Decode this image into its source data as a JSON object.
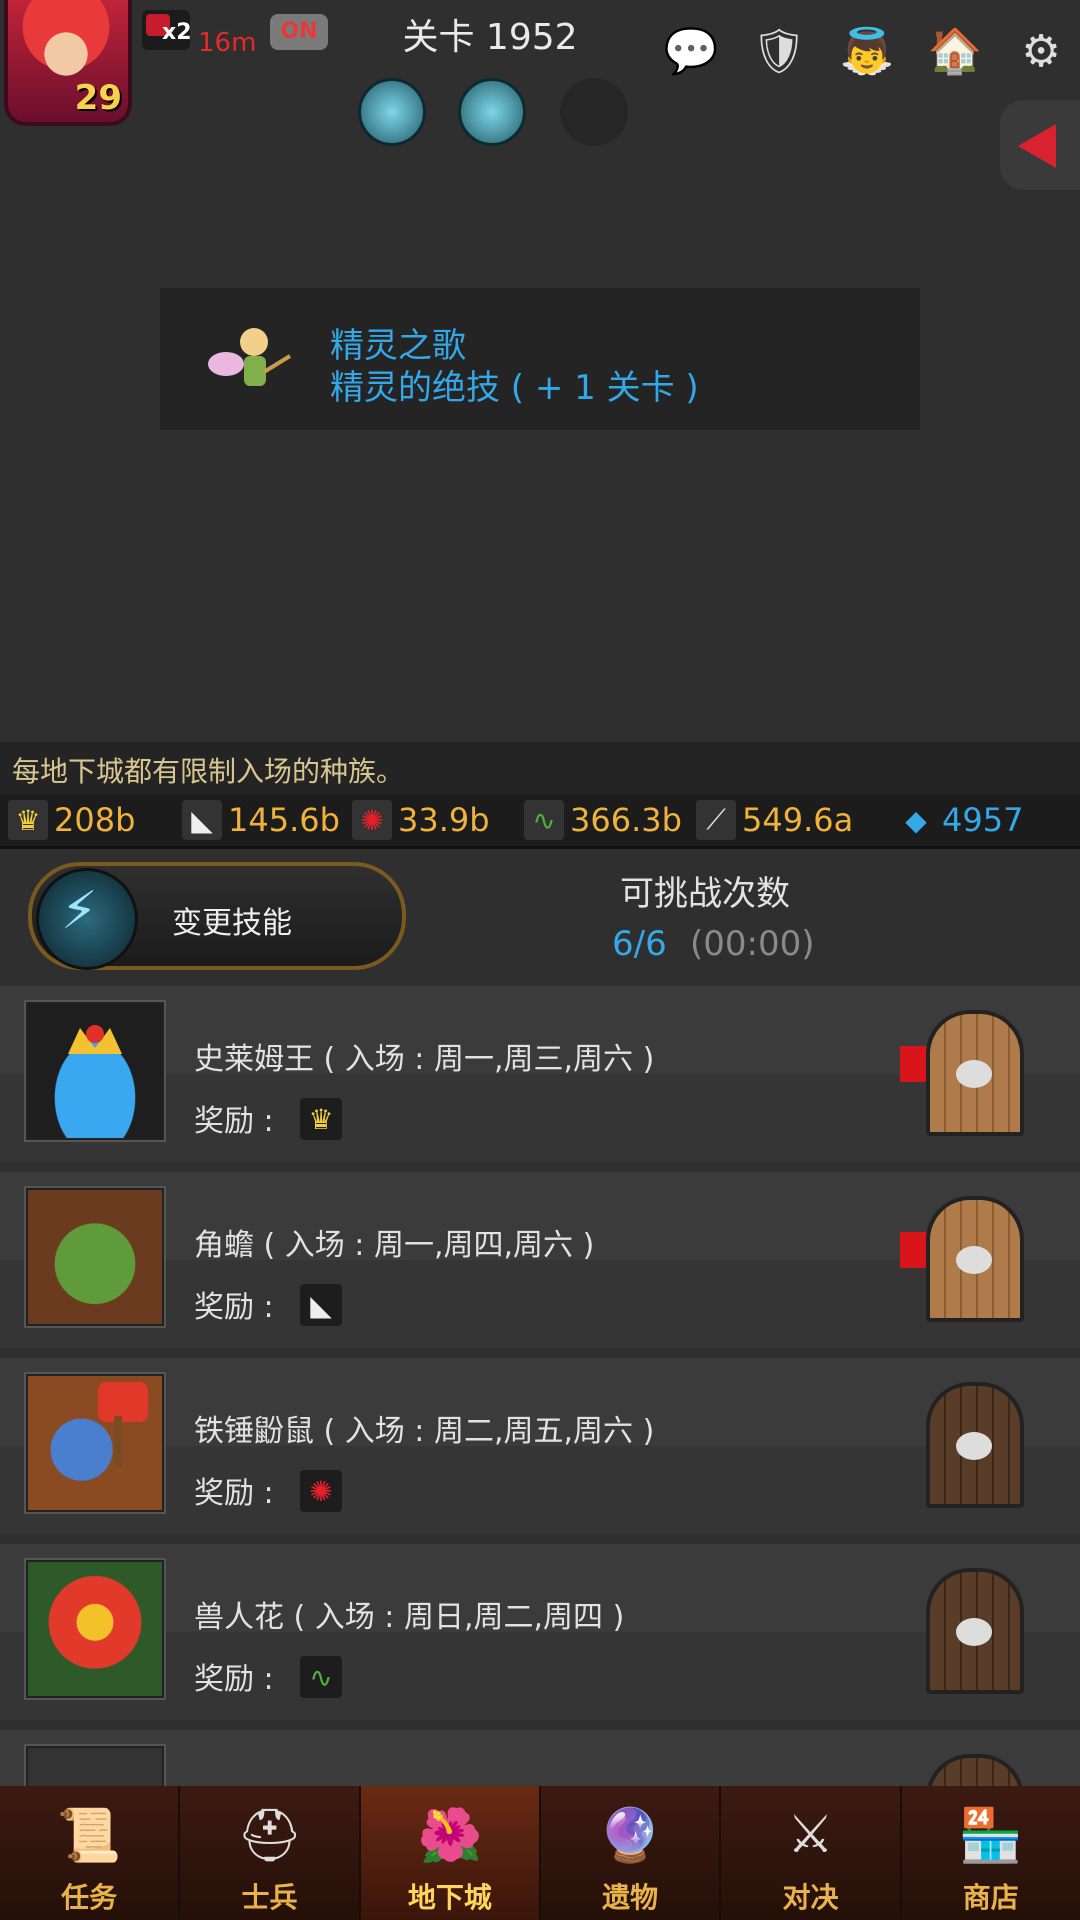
{
  "header": {
    "level": "29",
    "speed_multiplier": "x2",
    "speed_time": "16m",
    "toggle_label": "ON",
    "stage_title": "关卡 1952"
  },
  "notice": {
    "line1": "精灵之歌",
    "line2": "精灵的绝技 ( + 1 关卡 )"
  },
  "tip": "每地下城都有限制入场的种族。",
  "resources": [
    {
      "icon": "crown-icon",
      "value": "208b"
    },
    {
      "icon": "tooth-icon",
      "value": "145.6b"
    },
    {
      "icon": "claw-icon",
      "value": "33.9b"
    },
    {
      "icon": "vine-icon",
      "value": "366.3b"
    },
    {
      "icon": "blade-icon",
      "value": "549.6a"
    },
    {
      "icon": "gem-icon",
      "value": "4957"
    }
  ],
  "skill_button": {
    "label": "变更技能"
  },
  "tries": {
    "label": "可挑战次数",
    "count": "6/6",
    "timer": "(00:00)"
  },
  "reward_label": "奖励 :",
  "dungeons": [
    {
      "title": "史莱姆王 ( 入场 : 周一,周三,周六 )",
      "reward_icon": "crown-icon",
      "open": true
    },
    {
      "title": "角蟾 ( 入场 : 周一,周四,周六 )",
      "reward_icon": "tooth-icon",
      "open": true
    },
    {
      "title": "铁锤鼢鼠 ( 入场 : 周二,周五,周六 )",
      "reward_icon": "claw-icon",
      "open": false
    },
    {
      "title": "兽人花 ( 入场 : 周日,周二,周四 )",
      "reward_icon": "vine-icon",
      "open": false
    }
  ],
  "nav": [
    {
      "label": "任务",
      "icon": "scroll-icon"
    },
    {
      "label": "士兵",
      "icon": "helmet-icon"
    },
    {
      "label": "地下城",
      "icon": "flower-monster-icon",
      "active": true
    },
    {
      "label": "遗物",
      "icon": "orb-icon"
    },
    {
      "label": "对决",
      "icon": "crossed-swords-icon"
    },
    {
      "label": "商店",
      "icon": "shop-icon"
    }
  ],
  "colors": {
    "accent_blue": "#35a8ea",
    "gold": "#f0b23a",
    "tip": "#d8c590"
  }
}
